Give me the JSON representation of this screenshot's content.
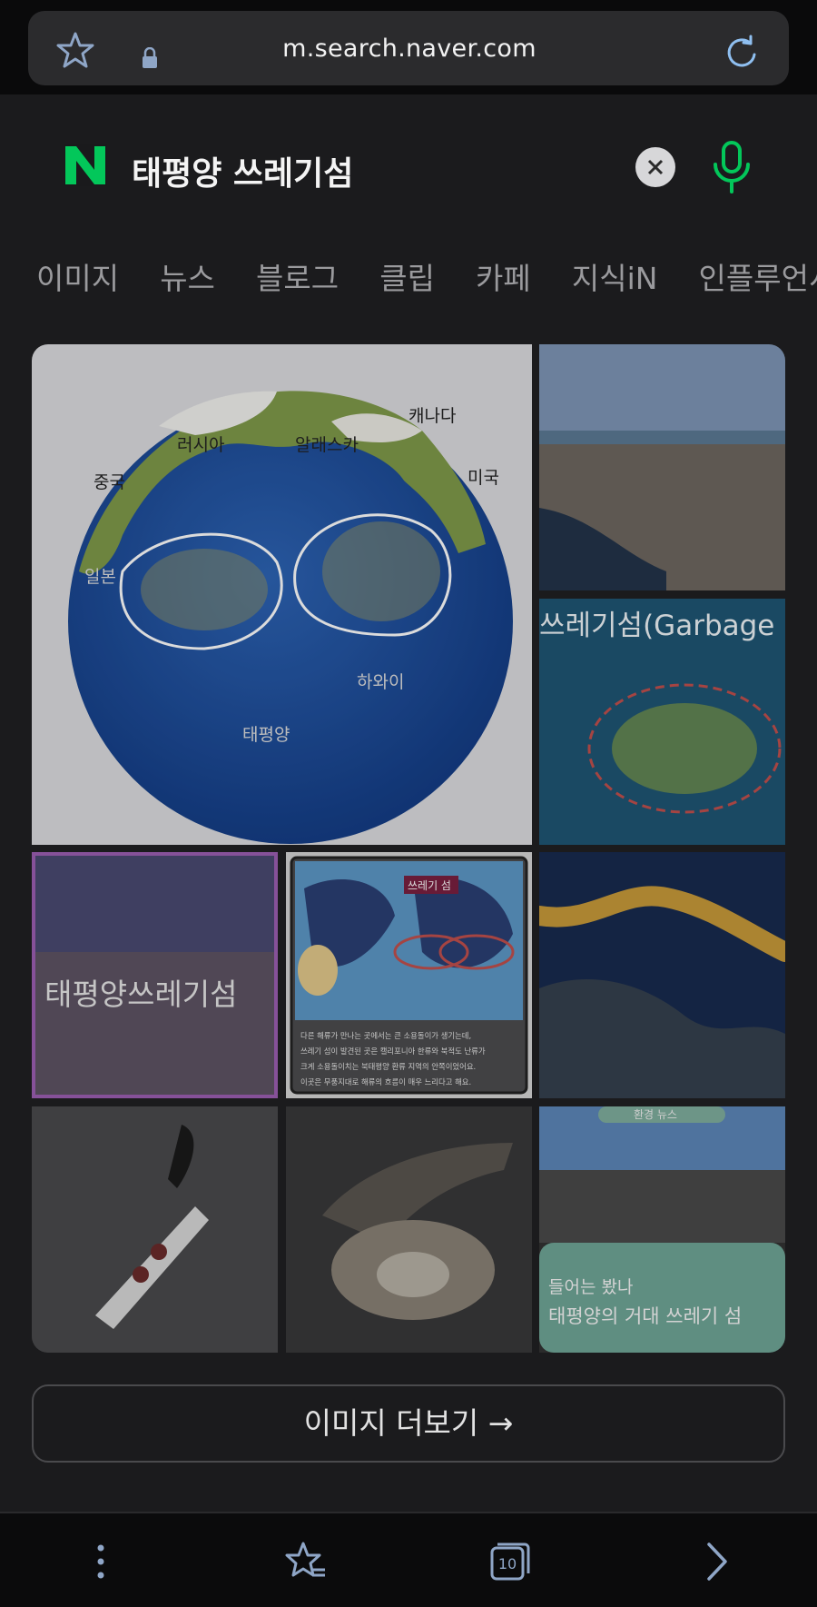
{
  "browser": {
    "url": "m.search.naver.com",
    "tab_count": "10"
  },
  "search": {
    "query": "태평양 쓰레기섬"
  },
  "tabs": [
    "이미지",
    "뉴스",
    "블로그",
    "클립",
    "카페",
    "지식iN",
    "인플루언서"
  ],
  "images": {
    "map_labels": {
      "canada": "캐나다",
      "russia": "러시아",
      "alaska": "알래스카",
      "china": "중국",
      "usa": "미국",
      "japan": "일본",
      "hawaii": "하와이",
      "pacific": "태평양"
    },
    "garbage_title": "쓰레기섬(Garbage",
    "purple_caption": "태평양쓰레기섬",
    "info_title": "쓰레기 섬",
    "info_lines": [
      "다른 해류가 만나는 곳에서는 큰 소용돌이가 생기는데,",
      "쓰레기 섬이 발견된 곳은 캘리포니아 한류와 북적도 난류가",
      "크게 소용돌이치는 북태평양 환류 지역의 안쪽이었어요.",
      "이곳은 무풍지대로 해류의 흐름이 매우 느리다고 해요."
    ],
    "news_badge": "환경 뉴스",
    "news_line1": "들어는 봤나",
    "news_line2": "태평양의 거대 쓰레기 섬"
  },
  "more_button": "이미지 더보기 →",
  "colors": {
    "naver_green": "#03c75a",
    "selected_outline": "#9c5fb3",
    "accent_blue": "#7cc0ff"
  }
}
